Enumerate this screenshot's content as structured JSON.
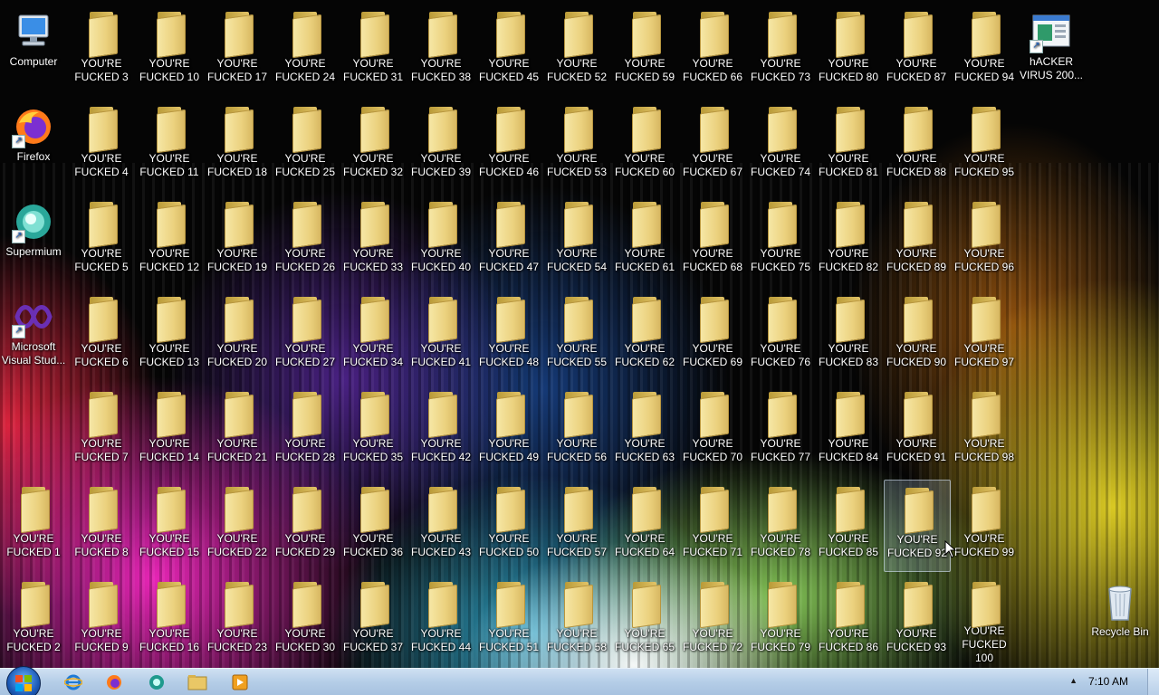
{
  "desktop": {
    "shortcuts": [
      {
        "label": "Computer",
        "icon": "computer-icon"
      },
      {
        "label": "Firefox",
        "icon": "firefox-icon"
      },
      {
        "label": "Supermium",
        "icon": "supermium-icon"
      },
      {
        "label": "Microsoft Visual Stud...",
        "icon": "visual-studio-icon"
      }
    ],
    "hacker_shortcut": {
      "label": "hACKER VIRUS 200...",
      "icon": "hacker-virus-icon"
    },
    "recycle_bin": {
      "label": "Recycle Bin",
      "icon": "recycle-bin-icon"
    },
    "folder_prefix": "YOU'RE",
    "folders": [
      "FUCKED 1",
      "FUCKED 2",
      "FUCKED 3",
      "FUCKED 4",
      "FUCKED 5",
      "FUCKED 6",
      "FUCKED 7",
      "FUCKED 8",
      "FUCKED 9",
      "FUCKED 10",
      "FUCKED 11",
      "FUCKED 12",
      "FUCKED 13",
      "FUCKED 14",
      "FUCKED 15",
      "FUCKED 16",
      "FUCKED 17",
      "FUCKED 18",
      "FUCKED 19",
      "FUCKED 20",
      "FUCKED 21",
      "FUCKED 22",
      "FUCKED 23",
      "FUCKED 24",
      "FUCKED 25",
      "FUCKED 26",
      "FUCKED 27",
      "FUCKED 28",
      "FUCKED 29",
      "FUCKED 30",
      "FUCKED 31",
      "FUCKED 32",
      "FUCKED 33",
      "FUCKED 34",
      "FUCKED 35",
      "FUCKED 36",
      "FUCKED 37",
      "FUCKED 38",
      "FUCKED 39",
      "FUCKED 40",
      "FUCKED 41",
      "FUCKED 42",
      "FUCKED 43",
      "FUCKED 44",
      "FUCKED 45",
      "FUCKED 46",
      "FUCKED 47",
      "FUCKED 48",
      "FUCKED 49",
      "FUCKED 50",
      "FUCKED 51",
      "FUCKED 52",
      "FUCKED 53",
      "FUCKED 54",
      "FUCKED 55",
      "FUCKED 56",
      "FUCKED 57",
      "FUCKED 58",
      "FUCKED 59",
      "FUCKED 60",
      "FUCKED 61",
      "FUCKED 62",
      "FUCKED 63",
      "FUCKED 64",
      "FUCKED 65",
      "FUCKED 66",
      "FUCKED 67",
      "FUCKED 68",
      "FUCKED 69",
      "FUCKED 70",
      "FUCKED 71",
      "FUCKED 72",
      "FUCKED 73",
      "FUCKED 74",
      "FUCKED 75",
      "FUCKED 76",
      "FUCKED 77",
      "FUCKED 78",
      "FUCKED 79",
      "FUCKED 80",
      "FUCKED 81",
      "FUCKED 82",
      "FUCKED 83",
      "FUCKED 84",
      "FUCKED 85",
      "FUCKED 86",
      "FUCKED 87",
      "FUCKED 88",
      "FUCKED 89",
      "FUCKED 90",
      "FUCKED 91",
      "FUCKED 92",
      "FUCKED 93",
      "FUCKED 94",
      "FUCKED 95",
      "FUCKED 96",
      "FUCKED 97",
      "FUCKED 98",
      "FUCKED 99",
      "FUCKED 100"
    ],
    "selected_folder": "FUCKED 92"
  },
  "taskbar": {
    "start_icon": "windows-start-icon",
    "pinned": [
      "internet-explorer-icon",
      "firefox-icon",
      "supermium-icon",
      "file-explorer-icon",
      "media-player-icon"
    ],
    "clock": "7:10 AM",
    "tray_arrow": "▲"
  },
  "colors": {
    "taskbar": "#b4cde7",
    "folder": "#ebd17e"
  }
}
